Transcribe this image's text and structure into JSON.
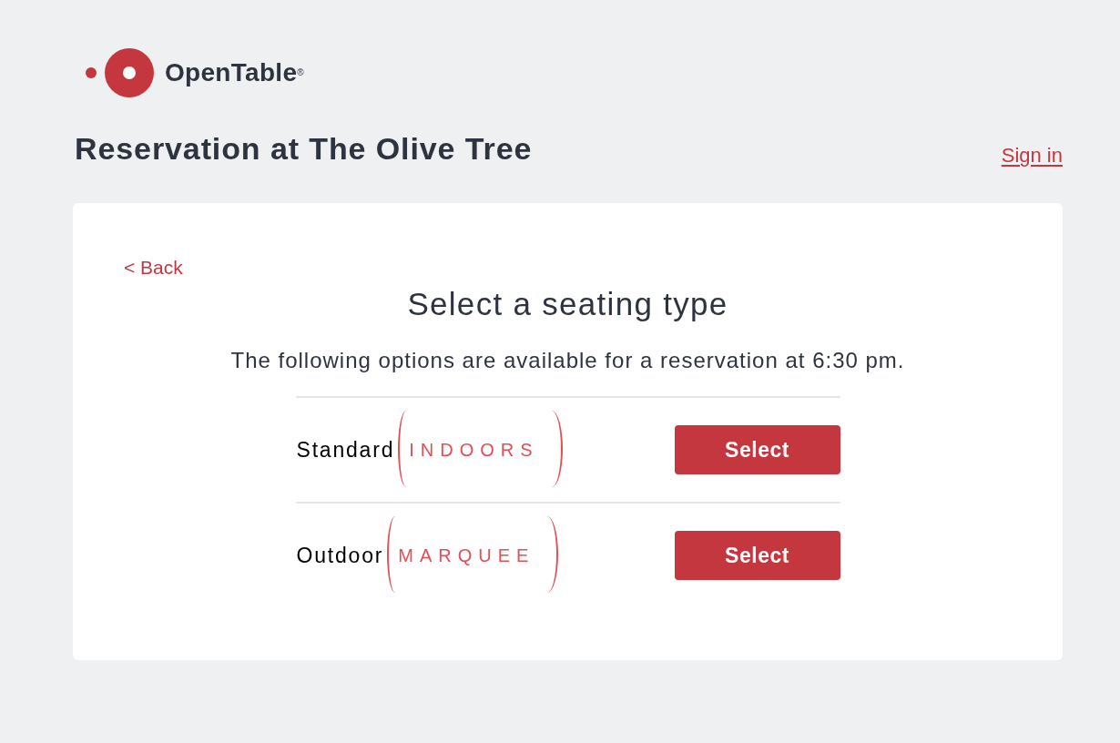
{
  "logo": {
    "wordmark": "OpenTable$^{®}$"
  },
  "header": {
    "title": "Reservation at The Olive Tree",
    "sign_in": "Sign in"
  },
  "card": {
    "back": "< Back",
    "heading": "Select a seating type",
    "description": "The following options are available for a reservation at 6:30 pm.",
    "options": [
      {
        "label": "Standard",
        "annotation": "INDOORS",
        "button": "Select"
      },
      {
        "label": "Outdoor",
        "annotation": "MARQUEE",
        "button": "Select"
      }
    ]
  }
}
